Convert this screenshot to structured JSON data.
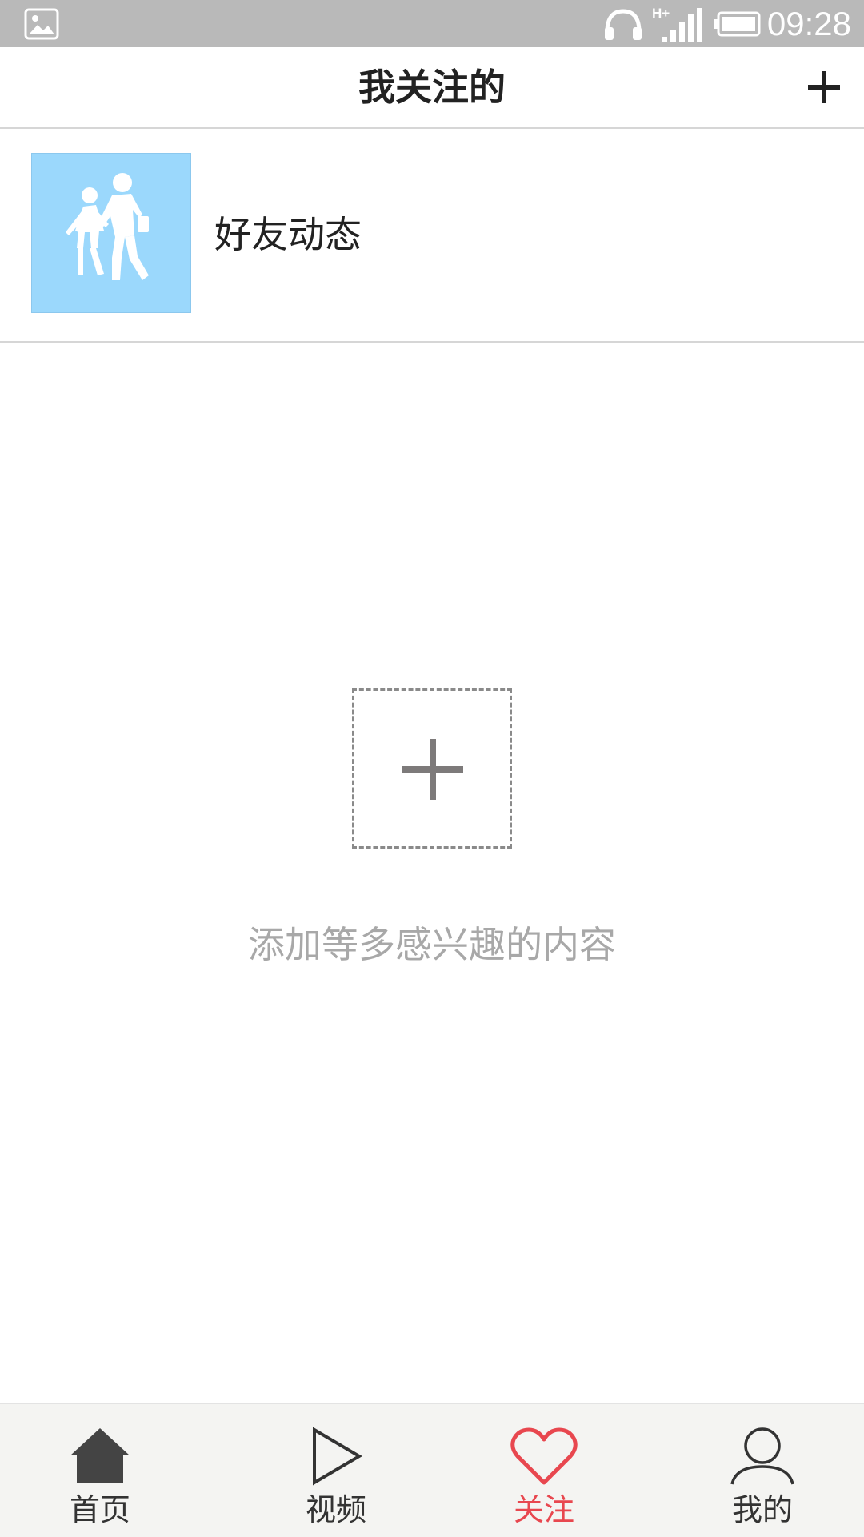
{
  "status_bar": {
    "time": "09:28",
    "network": "H+",
    "icons": [
      "gallery-icon",
      "headphones-icon",
      "signal-icon",
      "battery-icon"
    ],
    "background": "#b9b9b9"
  },
  "header": {
    "title": "我关注的",
    "add_icon": "plus-icon"
  },
  "feed": {
    "items": [
      {
        "label": "好友动态",
        "icon": "pedestrians-icon",
        "thumb_color": "#9bd8fc"
      }
    ]
  },
  "empty_state": {
    "add_icon": "plus-icon",
    "hint": "添加等多感兴趣的内容"
  },
  "bottom_nav": {
    "items": [
      {
        "label": "首页",
        "icon": "home-icon",
        "active": false
      },
      {
        "label": "视频",
        "icon": "play-icon",
        "active": false
      },
      {
        "label": "关注",
        "icon": "heart-icon",
        "active": true
      },
      {
        "label": "我的",
        "icon": "user-icon",
        "active": false
      }
    ],
    "active_color": "#e8474f",
    "inactive_color": "#333333"
  }
}
